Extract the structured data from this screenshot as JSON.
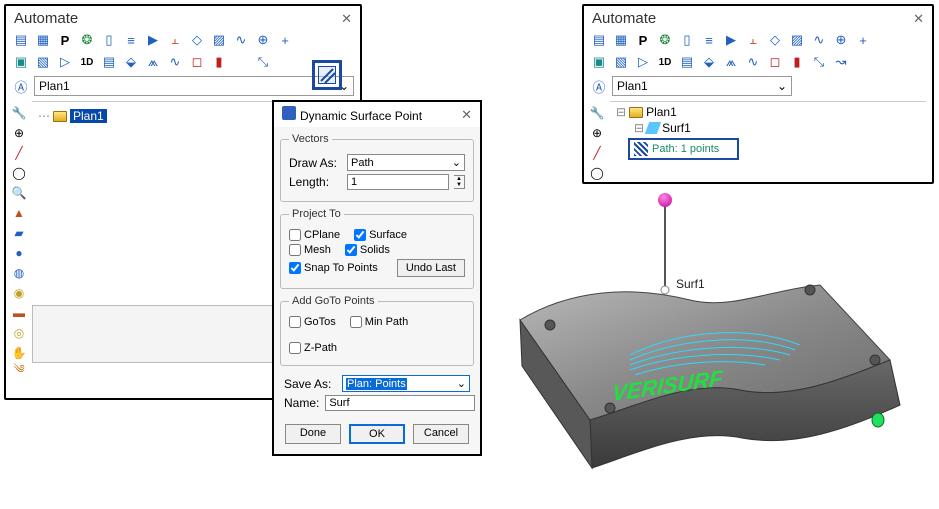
{
  "panel_left": {
    "title": "Automate",
    "plan_dropdown": "Plan1",
    "tree_root": "Plan1"
  },
  "panel_right": {
    "title": "Automate",
    "plan_dropdown": "Plan1",
    "tree_root": "Plan1",
    "surf_node": "Surf1",
    "path_node": "Path: 1 points"
  },
  "dialog": {
    "title": "Dynamic Surface Point",
    "vectors_legend": "Vectors",
    "draw_as_label": "Draw As:",
    "draw_as_value": "Path",
    "length_label": "Length:",
    "length_value": "1",
    "project_legend": "Project To",
    "chk_cplane": "CPlane",
    "chk_surface": "Surface",
    "chk_mesh": "Mesh",
    "chk_solids": "Solids",
    "chk_snap": "Snap To Points",
    "undo_last": "Undo Last",
    "goto_legend": "Add GoTo Points",
    "chk_gotos": "GoTos",
    "chk_minpath": "Min Path",
    "chk_zpath": "Z-Path",
    "save_as_label": "Save As:",
    "save_as_value": "Plan: Points",
    "name_label": "Name:",
    "name_value": "Surf",
    "btn_done": "Done",
    "btn_ok": "OK",
    "btn_cancel": "Cancel"
  },
  "scene": {
    "label": "Surf1",
    "logo_text": "VERISURF"
  },
  "toolbar_icons_row1": [
    "list-icon",
    "grid-icon",
    "p-icon",
    "bug-icon",
    "doc-icon",
    "bars-icon",
    "play-icon",
    "robot-icon",
    "diamond-icon",
    "hatch-icon",
    "swoosh-icon",
    "target-icon",
    "plus-icon"
  ],
  "toolbar_icons_row2": [
    "cube-icon",
    "cube2-icon",
    "play2-icon",
    "1d-icon",
    "grid2-icon",
    "chart-icon",
    "graph-icon",
    "curve-icon",
    "square-icon",
    "thermo-icon",
    "blank-icon",
    "strike-icon"
  ],
  "side_icons": [
    "wrench-icon",
    "target2-icon",
    "line-icon",
    "circle-icon",
    "search-icon",
    "cone-icon",
    "box-icon",
    "sphere-icon",
    "torus-icon",
    "disc-icon",
    "cyl-icon",
    "disc2-icon",
    "hand-icon",
    "swirl-icon"
  ]
}
